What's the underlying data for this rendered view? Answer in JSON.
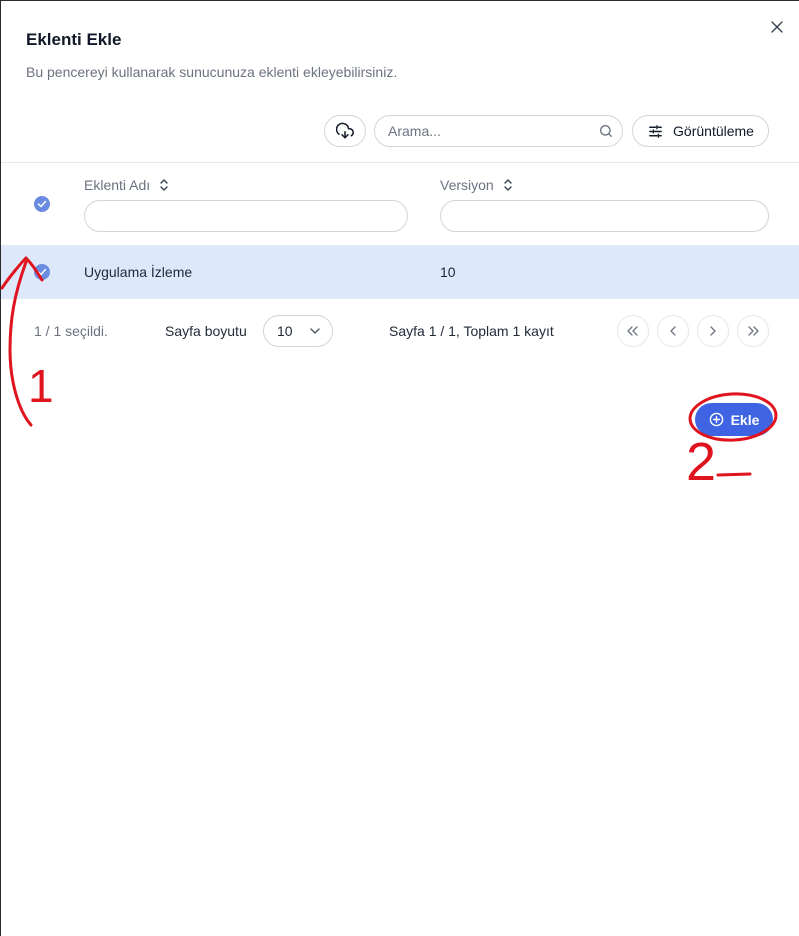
{
  "dialog": {
    "title": "Eklenti Ekle",
    "subtitle": "Bu pencereyi kullanarak sunucunuza eklenti ekleyebilirsiniz.",
    "close_icon": "close-icon"
  },
  "toolbar": {
    "download_icon": "cloud-download-icon",
    "search_placeholder": "Arama...",
    "search_value": "",
    "view_label": "Görüntüleme",
    "view_icon": "sliders-icon"
  },
  "table": {
    "columns": [
      {
        "label": "Eklenti Adı",
        "filter_value": ""
      },
      {
        "label": "Versiyon",
        "filter_value": ""
      }
    ],
    "rows": [
      {
        "name": "Uygulama İzleme",
        "version": "10",
        "selected": true
      }
    ],
    "header_checked": true
  },
  "pagination": {
    "selected_text": "1 / 1 seçildi.",
    "page_size_label": "Sayfa boyutu",
    "page_size_value": "10",
    "page_info": "Sayfa 1 / 1, Toplam 1 kayıt"
  },
  "actions": {
    "add_label": "Ekle",
    "add_icon": "plus-circle-icon"
  },
  "annotations": {
    "mark_1": "1",
    "mark_2": "2",
    "color": "#e0141e"
  },
  "colors": {
    "accent": "#3e64e3",
    "checkbox": "#6a8ce0",
    "selected_row": "#dde9fb"
  }
}
